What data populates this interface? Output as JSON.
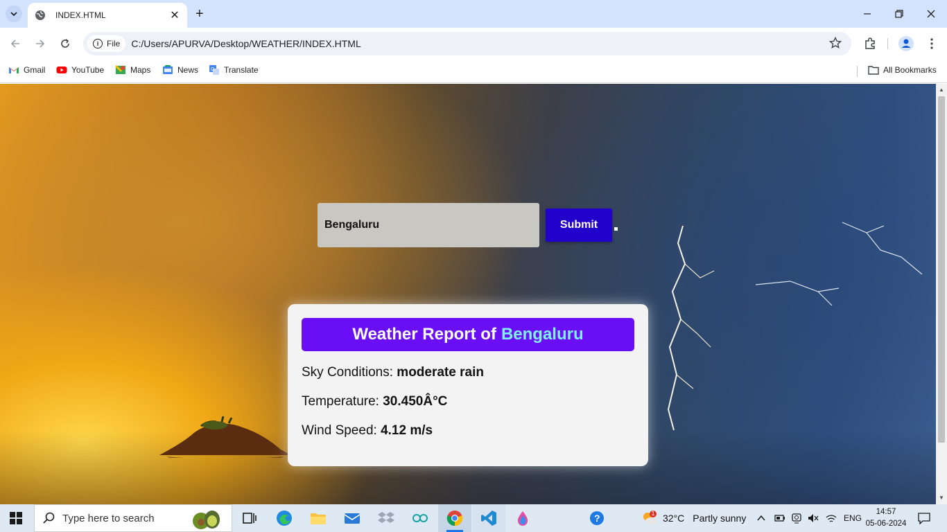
{
  "browser": {
    "tab_title": "INDEX.HTML",
    "chip_label": "File",
    "url": "C:/Users/APURVA/Desktop/WEATHER/INDEX.HTML",
    "bookmarks": [
      "Gmail",
      "YouTube",
      "Maps",
      "News",
      "Translate"
    ],
    "all_bookmarks": "All Bookmarks"
  },
  "page": {
    "city_input_value": "Bengaluru",
    "submit_label": "Submit",
    "card": {
      "title_prefix": "Weather Report of",
      "title_city": "Bengaluru",
      "sky_label": "Sky Conditions:",
      "sky_value": "moderate rain",
      "temp_label": "Temperature:",
      "temp_value": "30.450Â°C",
      "wind_label": "Wind Speed:",
      "wind_value": "4.12 m/s"
    }
  },
  "taskbar": {
    "search_placeholder": "Type here to search",
    "weather_temp": "32°C",
    "weather_desc": "Partly sunny",
    "weather_badge": "1",
    "language": "ENG",
    "time": "14:57",
    "date": "05-06-2024"
  },
  "colors": {
    "submit_bg": "#2200cc",
    "card_header_bg": "#6a0ff5",
    "card_city": "#7ff0f5"
  }
}
